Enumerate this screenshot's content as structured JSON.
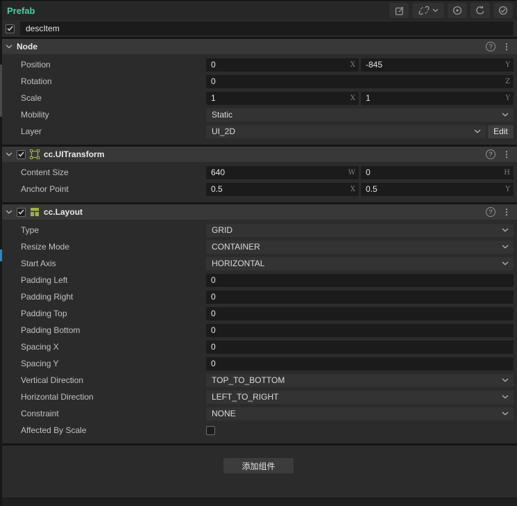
{
  "panel": {
    "title": "Prefab",
    "toolbar_icons": [
      "edit-prefab-icon",
      "unlink-icon",
      "chevron-down-icon",
      "locate-icon",
      "undo-icon",
      "confirm-icon"
    ]
  },
  "node": {
    "name": "descItem",
    "enabled": true
  },
  "icon_glyphs": {
    "help_icon": "?",
    "menu_icon": "⋮"
  },
  "colors": {
    "accent_green": "#3fd6a0",
    "component_icon": "#9cb43c",
    "input_bg": "#1b1b1b",
    "select_bg": "#333333"
  },
  "sections": [
    {
      "id": "node",
      "title": "Node",
      "has_checkbox": false,
      "icon": null,
      "rows": [
        {
          "label": "Position",
          "type": "inputs",
          "fields": [
            {
              "value": "0",
              "suffix": "X"
            },
            {
              "value": "-845",
              "suffix": "Y"
            }
          ]
        },
        {
          "label": "Rotation",
          "type": "inputs",
          "fields": [
            {
              "value": "0",
              "suffix": "Z"
            }
          ]
        },
        {
          "label": "Scale",
          "type": "inputs",
          "fields": [
            {
              "value": "1",
              "suffix": "X"
            },
            {
              "value": "1",
              "suffix": "Y"
            }
          ]
        },
        {
          "label": "Mobility",
          "type": "select",
          "value": "Static"
        },
        {
          "label": "Layer",
          "type": "select",
          "value": "UI_2D",
          "edit_button": "Edit"
        }
      ]
    },
    {
      "id": "uitransform",
      "title": "cc.UITransform",
      "has_checkbox": true,
      "checked": true,
      "icon": "uitransform-icon",
      "rows": [
        {
          "label": "Content Size",
          "type": "inputs",
          "fields": [
            {
              "value": "640",
              "suffix": "W"
            },
            {
              "value": "0",
              "suffix": "H"
            }
          ]
        },
        {
          "label": "Anchor Point",
          "type": "inputs",
          "fields": [
            {
              "value": "0.5",
              "suffix": "X"
            },
            {
              "value": "0.5",
              "suffix": "Y"
            }
          ]
        }
      ]
    },
    {
      "id": "layout",
      "title": "cc.Layout",
      "has_checkbox": true,
      "checked": true,
      "icon": "layout-icon",
      "rows": [
        {
          "label": "Type",
          "type": "select",
          "value": "GRID"
        },
        {
          "label": "Resize Mode",
          "type": "select",
          "value": "CONTAINER"
        },
        {
          "label": "Start Axis",
          "type": "select",
          "value": "HORIZONTAL"
        },
        {
          "label": "Padding Left",
          "type": "inputs",
          "fields": [
            {
              "value": "0"
            }
          ]
        },
        {
          "label": "Padding Right",
          "type": "inputs",
          "fields": [
            {
              "value": "0"
            }
          ]
        },
        {
          "label": "Padding Top",
          "type": "inputs",
          "fields": [
            {
              "value": "0"
            }
          ]
        },
        {
          "label": "Padding Bottom",
          "type": "inputs",
          "fields": [
            {
              "value": "0"
            }
          ]
        },
        {
          "label": "Spacing X",
          "type": "inputs",
          "fields": [
            {
              "value": "0"
            }
          ]
        },
        {
          "label": "Spacing Y",
          "type": "inputs",
          "fields": [
            {
              "value": "0"
            }
          ]
        },
        {
          "label": "Vertical Direction",
          "type": "select",
          "value": "TOP_TO_BOTTOM"
        },
        {
          "label": "Horizontal Direction",
          "type": "select",
          "value": "LEFT_TO_RIGHT"
        },
        {
          "label": "Constraint",
          "type": "select",
          "value": "NONE"
        },
        {
          "label": "Affected By Scale",
          "type": "checkbox",
          "checked": false
        }
      ]
    }
  ],
  "footer": {
    "add_component_label": "添加组件"
  }
}
